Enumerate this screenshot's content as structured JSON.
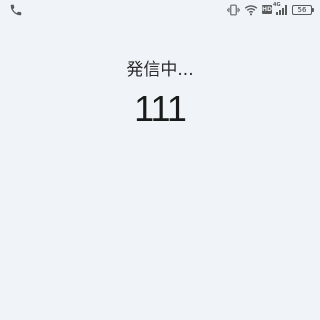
{
  "status_bar": {
    "left_icon": "phone-icon",
    "right_icons": [
      "vibrate-icon",
      "wifi-icon",
      "hd-icon",
      "signal-icon",
      "battery-icon"
    ],
    "hd_label": "HD",
    "network_gen": "4G",
    "battery_level": "56"
  },
  "call": {
    "status": "発信中...",
    "number": "111"
  },
  "colors": {
    "background": "#f0f3f8",
    "text": "#1f1f1f",
    "icon": "#5a5a5a"
  }
}
